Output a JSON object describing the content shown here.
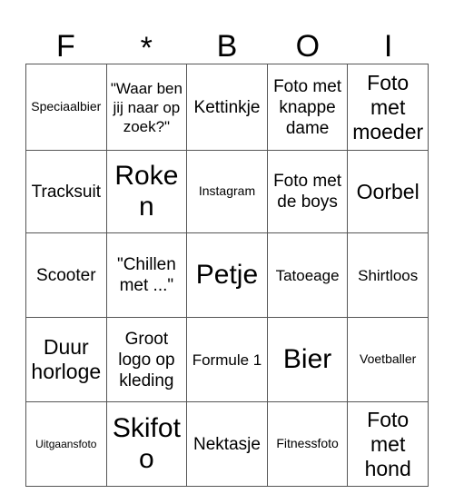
{
  "card": {
    "header": {
      "letters": [
        "F",
        "*",
        "B",
        "O",
        "I"
      ]
    },
    "columns": 5,
    "rows": 5,
    "cells": [
      [
        {
          "text": "Speciaalbier",
          "size": "fs-sm"
        },
        {
          "text": "\"Waar ben jij naar op zoek?\"",
          "size": "fs-md"
        },
        {
          "text": "Kettinkje",
          "size": "fs-lg"
        },
        {
          "text": "Foto met knappe dame",
          "size": "fs-lg"
        },
        {
          "text": "Foto met moeder",
          "size": "fs-xl"
        }
      ],
      [
        {
          "text": "Tracksuit",
          "size": "fs-lg"
        },
        {
          "text": "Roken",
          "size": "fs-xxl"
        },
        {
          "text": "Instagram",
          "size": "fs-sm"
        },
        {
          "text": "Foto met de boys",
          "size": "fs-lg"
        },
        {
          "text": "Oorbel",
          "size": "fs-xl"
        }
      ],
      [
        {
          "text": "Scooter",
          "size": "fs-lg"
        },
        {
          "text": "\"Chillen met ...\"",
          "size": "fs-lg"
        },
        {
          "text": "Petje",
          "size": "fs-xxl"
        },
        {
          "text": "Tatoeage",
          "size": "fs-md"
        },
        {
          "text": "Shirtloos",
          "size": "fs-md"
        }
      ],
      [
        {
          "text": "Duur horloge",
          "size": "fs-xl"
        },
        {
          "text": "Groot logo op kleding",
          "size": "fs-lg"
        },
        {
          "text": "Formule 1",
          "size": "fs-md"
        },
        {
          "text": "Bier",
          "size": "fs-xxl"
        },
        {
          "text": "Voetballer",
          "size": "fs-sm"
        }
      ],
      [
        {
          "text": "Uitgaansfoto",
          "size": "fs-xs"
        },
        {
          "text": "Skifoto",
          "size": "fs-xxl"
        },
        {
          "text": "Nektasje",
          "size": "fs-lg"
        },
        {
          "text": "Fitnessfoto",
          "size": "fs-sm"
        },
        {
          "text": "Foto met hond",
          "size": "fs-xl"
        }
      ]
    ]
  },
  "colors": {
    "background": "#ffffff",
    "text": "#000000",
    "grid_line": "#555555"
  }
}
